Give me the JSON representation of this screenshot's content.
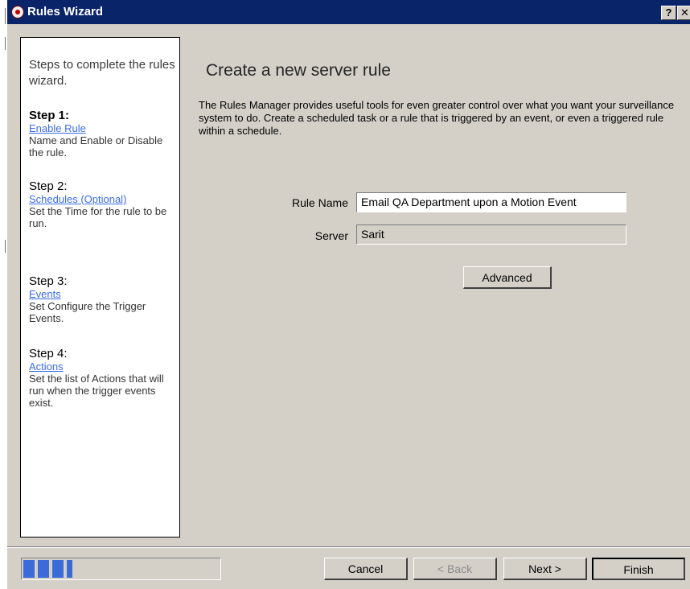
{
  "window": {
    "title": "Rules Wizard",
    "help_label": "?",
    "close_label": "✕"
  },
  "steps_panel": {
    "intro": "Steps to complete the rules wizard.",
    "steps": [
      {
        "title": "Step 1:",
        "link": "Enable Rule",
        "description": "Name and Enable or Disable the rule."
      },
      {
        "title": "Step 2:",
        "link": "Schedules (Optional)",
        "description": "Set the Time for the rule to be run."
      },
      {
        "title": "Step 3:",
        "link": "Events",
        "description": "Set Configure the Trigger Events."
      },
      {
        "title": "Step 4:",
        "link": "Actions",
        "description": "Set the list of Actions that will run when the trigger events exist."
      }
    ]
  },
  "main": {
    "heading": "Create a new server rule",
    "description": "The Rules Manager provides useful tools for even greater control over what you want your surveillance system to do. Create a scheduled task or a rule that is triggered by an event, or even a triggered rule within a schedule.",
    "rule_name": {
      "label": "Rule Name",
      "value": "Email QA Department upon a Motion Event"
    },
    "server": {
      "label": "Server",
      "value": "Sarit"
    },
    "advanced_label": "Advanced"
  },
  "footer": {
    "progress_fraction": 0.25,
    "cancel_label": "Cancel",
    "back_label": "< Back",
    "next_label": "Next >",
    "finish_label": "Finish"
  },
  "colors": {
    "titlebar": "#0a246a",
    "dialog_background": "#d4d0c8",
    "link": "#3a6be8",
    "progress_fill": "#3a6bd8"
  }
}
